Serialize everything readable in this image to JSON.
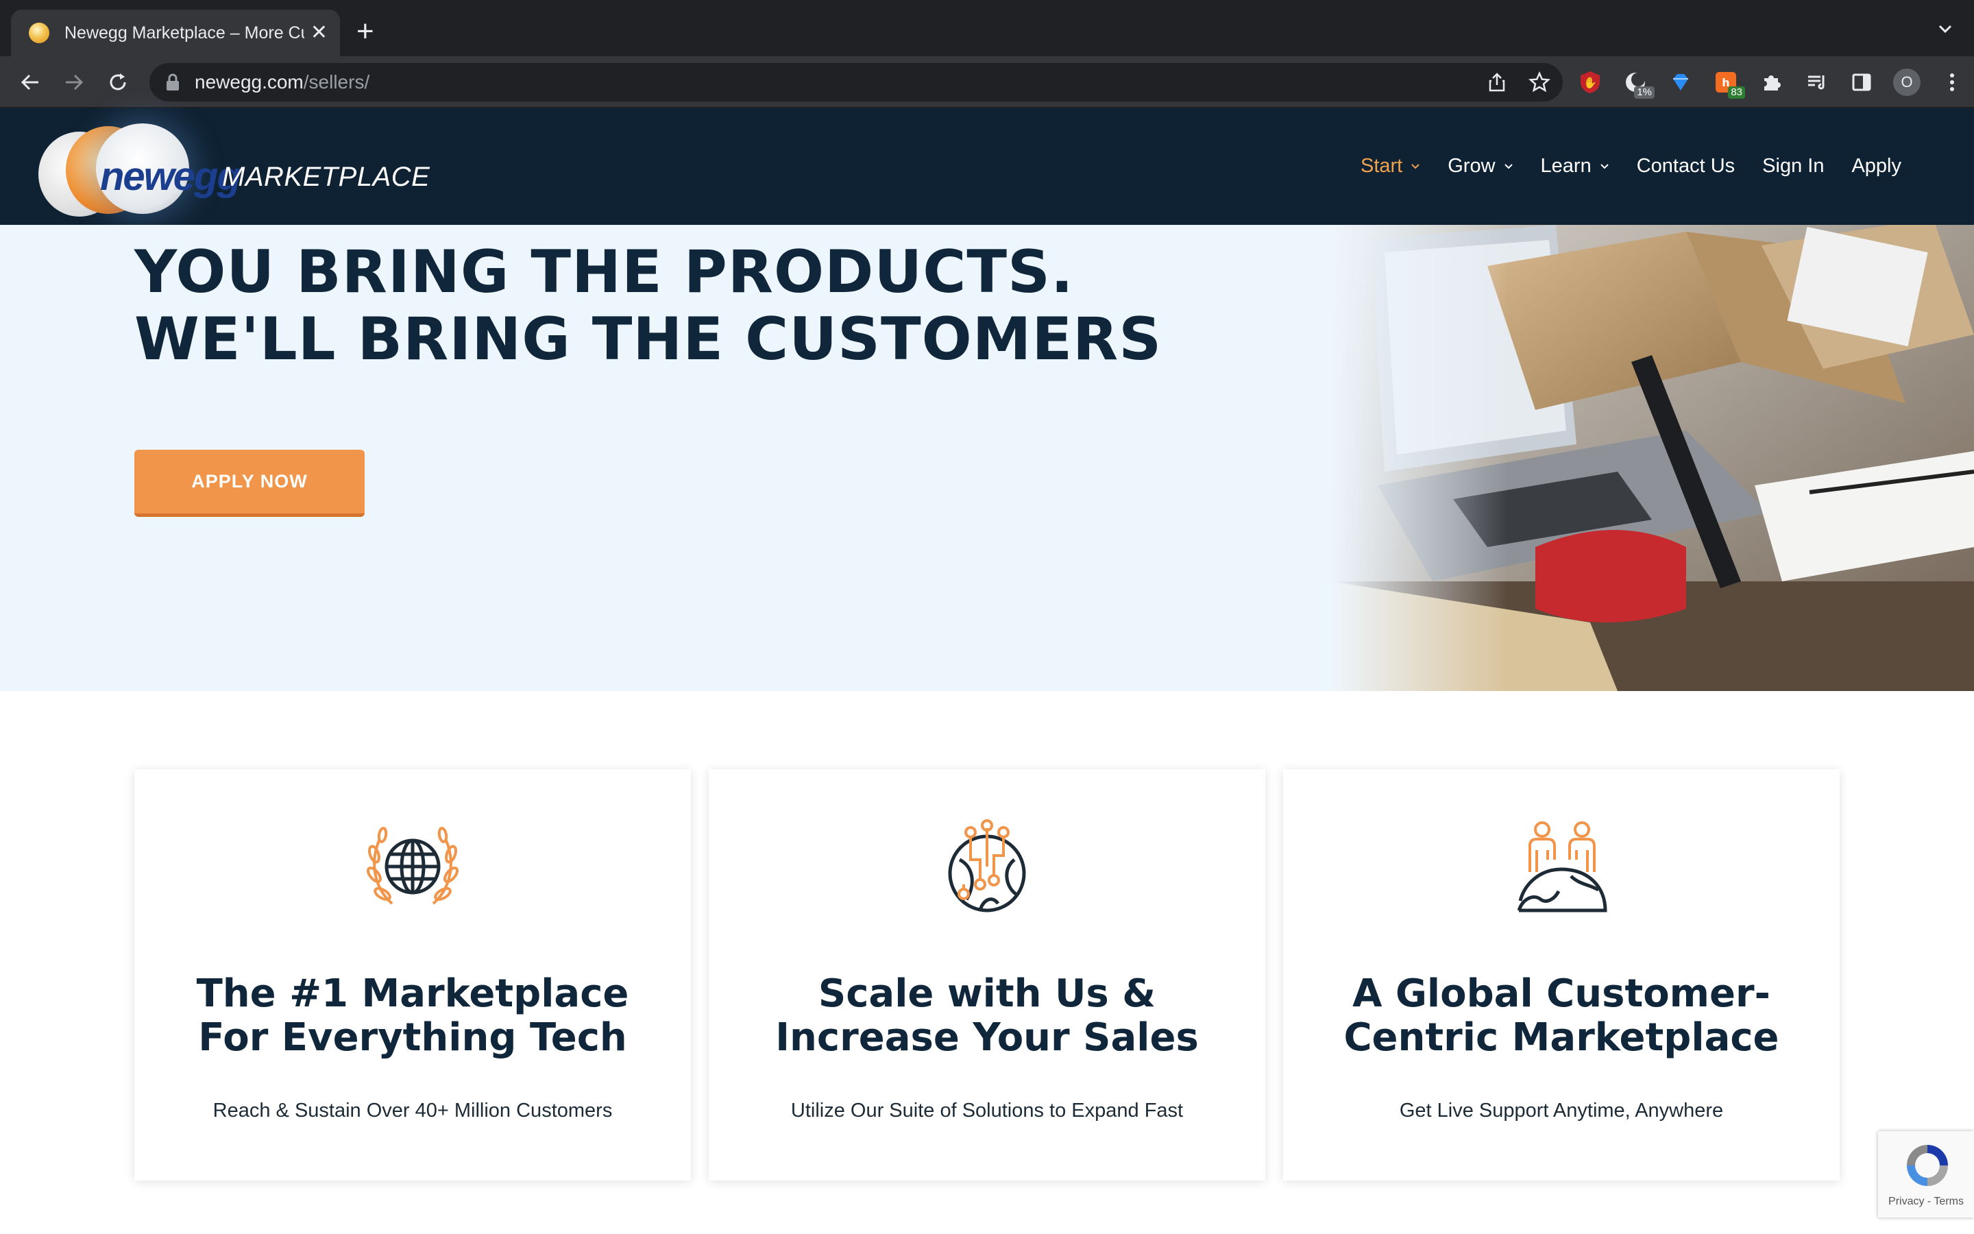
{
  "browser": {
    "tab_title": "Newegg Marketplace – More Customers",
    "url_host": "newegg.com",
    "url_path": "/sellers/",
    "extensions": [
      {
        "name": "ublock-icon",
        "badge": ""
      },
      {
        "name": "dark-reader-icon",
        "badge": "1%"
      },
      {
        "name": "diamond-icon",
        "badge": ""
      },
      {
        "name": "honey-icon",
        "badge": "83"
      },
      {
        "name": "puzzle-icon",
        "badge": ""
      },
      {
        "name": "reading-list-icon",
        "badge": ""
      },
      {
        "name": "side-panel-icon",
        "badge": ""
      }
    ],
    "profile_initial": "O"
  },
  "header": {
    "logo_word": "newegg",
    "logo_marketplace": "MARKETPLACE",
    "nav": [
      {
        "label": "Start",
        "dropdown": true,
        "active": true
      },
      {
        "label": "Grow",
        "dropdown": true,
        "active": false
      },
      {
        "label": "Learn",
        "dropdown": true,
        "active": false
      },
      {
        "label": "Contact Us",
        "dropdown": false,
        "active": false
      },
      {
        "label": "Sign In",
        "dropdown": false,
        "active": false
      },
      {
        "label": "Apply",
        "dropdown": false,
        "active": false
      }
    ]
  },
  "hero": {
    "headline_line1": "YOU BRING THE PRODUCTS.",
    "headline_line2": "WE'LL BRING THE CUSTOMERS",
    "cta_label": "APPLY NOW"
  },
  "cards": [
    {
      "icon": "globe-laurel-icon",
      "title_line1": "The #1 Marketplace",
      "title_line2": "For Everything Tech",
      "subtitle": "Reach & Sustain Over 40+ Million Customers"
    },
    {
      "icon": "network-globe-icon",
      "title_line1": "Scale with Us &",
      "title_line2": "Increase Your Sales",
      "subtitle": "Utilize Our Suite of Solutions to Expand Fast"
    },
    {
      "icon": "people-globe-icon",
      "title_line1": "A Global Customer-",
      "title_line2": "Centric Marketplace",
      "subtitle": "Get Live Support Anytime, Anywhere"
    }
  ],
  "recaptcha": {
    "links": "Privacy - Terms"
  },
  "colors": {
    "header_bg": "#0f2233",
    "accent": "#f0954a",
    "hero_bg": "#eef6fd",
    "heading": "#10263a"
  }
}
